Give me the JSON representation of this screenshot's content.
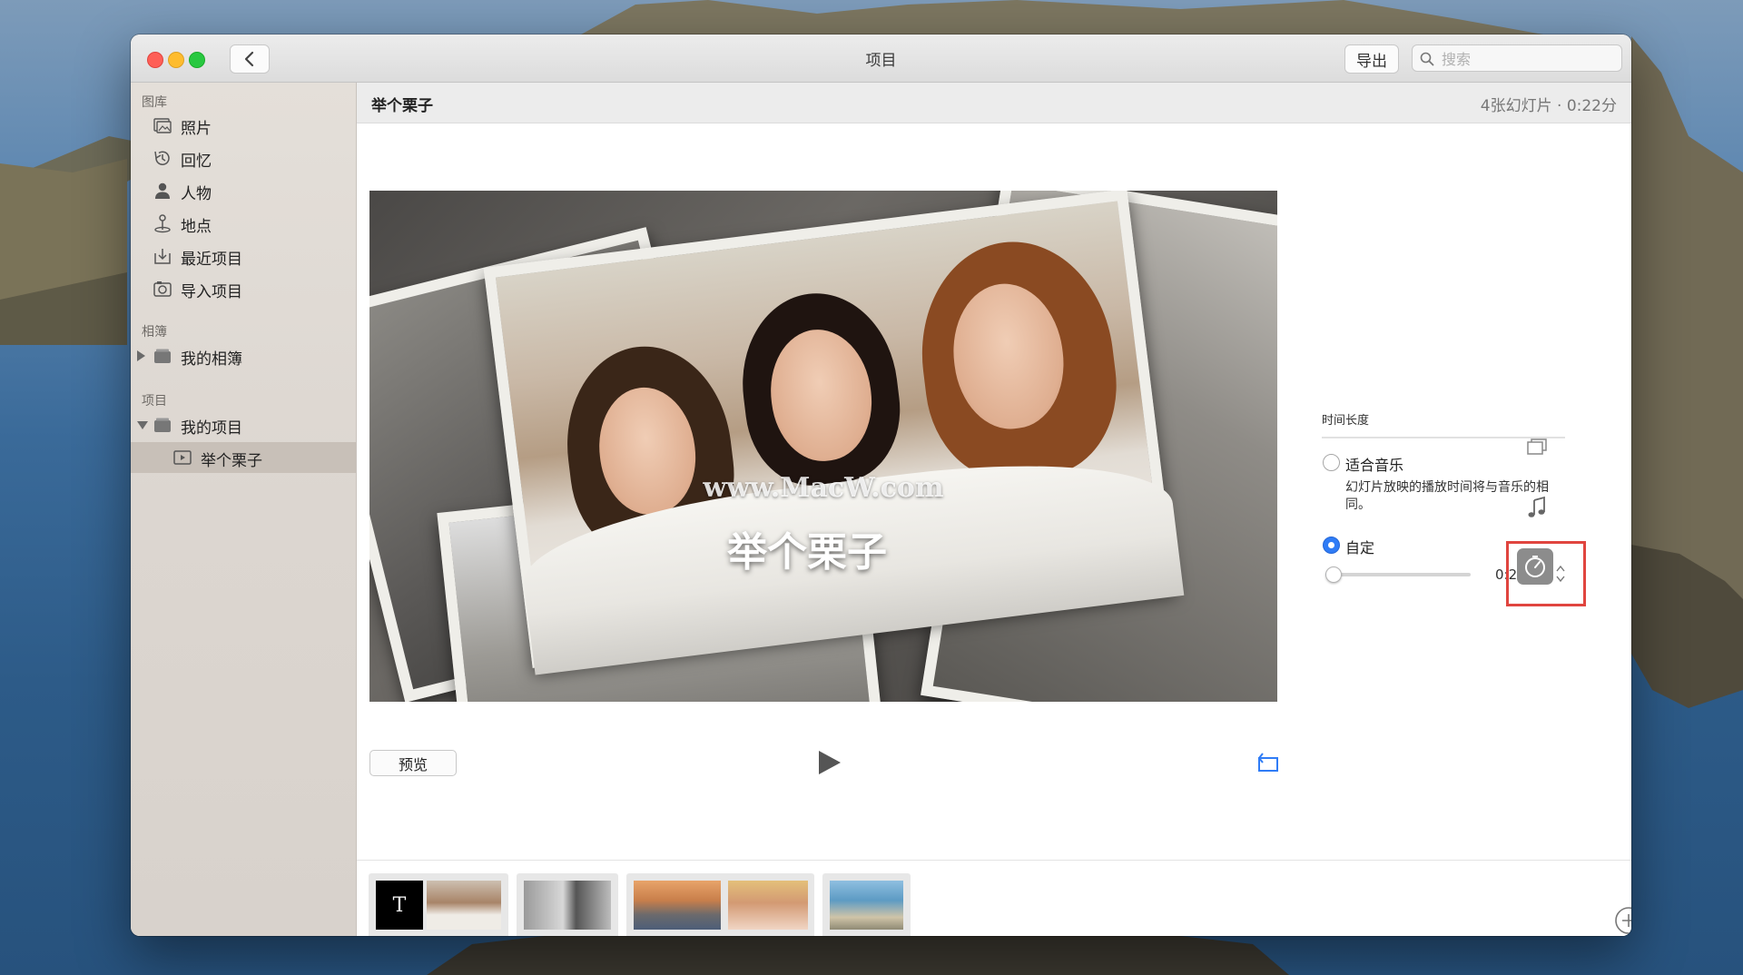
{
  "window": {
    "title": "项目",
    "export_label": "导出",
    "search_placeholder": "搜索"
  },
  "sidebar": {
    "library": {
      "header": "图库",
      "items": [
        {
          "label": "照片",
          "icon": "photos-icon"
        },
        {
          "label": "回忆",
          "icon": "memories-icon"
        },
        {
          "label": "人物",
          "icon": "people-icon"
        },
        {
          "label": "地点",
          "icon": "places-icon"
        },
        {
          "label": "最近项目",
          "icon": "recent-icon"
        },
        {
          "label": "导入项目",
          "icon": "import-icon"
        }
      ]
    },
    "albums": {
      "header": "相簿",
      "items": [
        {
          "label": "我的相簿",
          "icon": "folder-icon",
          "expanded": false
        }
      ]
    },
    "projects": {
      "header": "项目",
      "items": [
        {
          "label": "我的项目",
          "icon": "folder-icon",
          "expanded": true
        },
        {
          "label": "举个栗子",
          "icon": "slideshow-icon",
          "selected": true
        }
      ]
    }
  },
  "project": {
    "title": "举个栗子",
    "info": "4张幻灯片 · 0:22分"
  },
  "preview": {
    "slide_title": "举个栗子",
    "watermark": "www.MacW.com",
    "preview_label": "预览"
  },
  "duration_panel": {
    "label": "时间长度",
    "fit_music_label": "适合音乐",
    "fit_music_desc": "幻灯片放映的播放时间将与音乐的相同。",
    "custom_label": "自定",
    "selected_option": "custom",
    "value": "0:22分",
    "slider_fraction": 0.05
  },
  "slides": [
    {
      "number": "1",
      "title_glyph": "T"
    },
    {
      "number": "2"
    },
    {
      "number": "3"
    },
    {
      "number": "4"
    }
  ],
  "colors": {
    "accent": "#2f7cf6",
    "highlight_box": "#e0453f"
  }
}
